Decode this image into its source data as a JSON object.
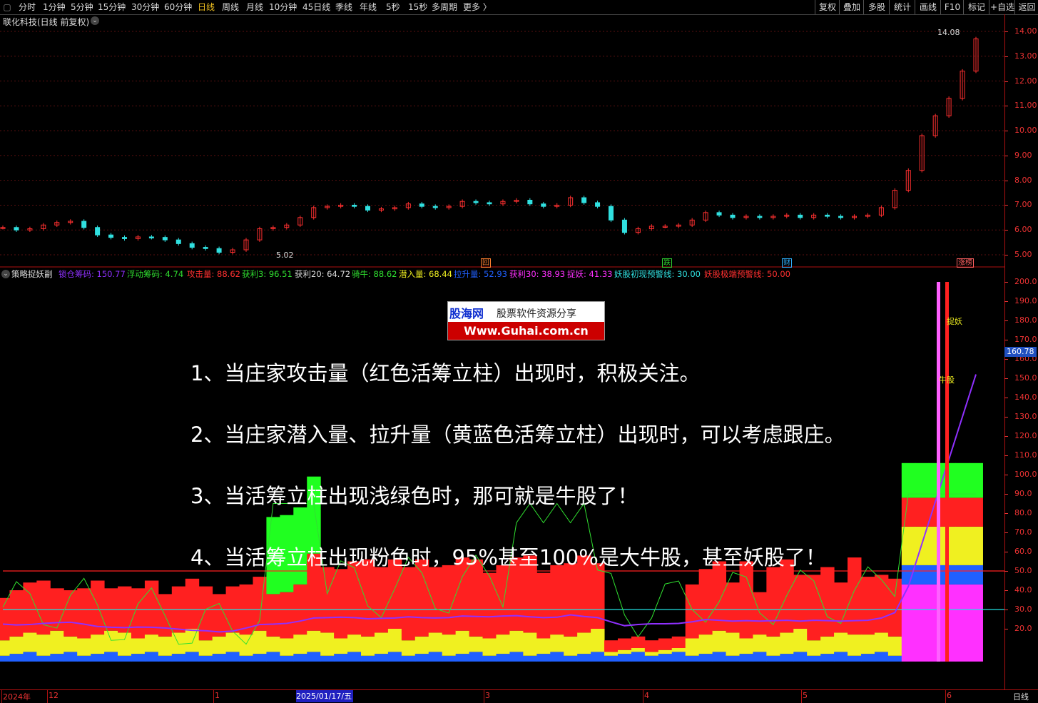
{
  "toolbar": {
    "periods": [
      "分时",
      "1分钟",
      "5分钟",
      "15分钟",
      "30分钟",
      "60分钟",
      "日线",
      "周线",
      "月线",
      "10分钟",
      "45日线",
      "季线",
      "年线",
      "5秒",
      "15秒",
      "多周期",
      "更多 〉"
    ],
    "active_period": "日线",
    "tools": [
      "复权",
      "叠加",
      "多股",
      "统计",
      "画线",
      "F10",
      "标记",
      "+自选",
      "返回"
    ]
  },
  "main_chart": {
    "title": "联化科技(日线 前复权)",
    "high_label": "14.08",
    "low_label": "5.02",
    "price_axis": [
      "14.00",
      "13.00",
      "12.00",
      "11.00",
      "10.00",
      "9.00",
      "8.00",
      "7.00",
      "6.00",
      "5.00"
    ],
    "markers": [
      {
        "text": "回",
        "color": "#ff8030"
      },
      {
        "text": "跌",
        "color": "#30d030"
      },
      {
        "text": "财",
        "color": "#30b0ff"
      },
      {
        "text": "涨榜",
        "color": "#ff6060"
      }
    ],
    "candles": [
      6.1,
      6.0,
      6.05,
      6.2,
      6.3,
      6.35,
      6.1,
      5.8,
      5.7,
      5.65,
      5.72,
      5.7,
      5.6,
      5.45,
      5.3,
      5.25,
      5.1,
      5.2,
      5.6,
      6.05,
      6.1,
      6.2,
      6.5,
      6.9,
      6.95,
      7.0,
      6.95,
      6.8,
      6.85,
      6.9,
      7.05,
      6.95,
      6.9,
      6.95,
      7.15,
      7.1,
      7.05,
      7.15,
      7.2,
      7.05,
      6.95,
      7.0,
      7.3,
      7.1,
      6.95,
      6.4,
      5.9,
      6.05,
      6.15,
      6.15,
      6.2,
      6.4,
      6.7,
      6.6,
      6.5,
      6.55,
      6.5,
      6.55,
      6.6,
      6.5,
      6.6,
      6.55,
      6.5,
      6.55,
      6.6,
      6.9,
      7.6,
      8.4,
      9.8,
      10.6,
      11.3,
      12.4,
      13.7
    ]
  },
  "indicator": {
    "name": "策略捉妖副",
    "items": [
      {
        "text": "锁仓筹码: 150.77",
        "color": "#9030ff"
      },
      {
        "text": "浮动筹码: 4.74",
        "color": "#30e030"
      },
      {
        "text": "攻击量: 88.62",
        "color": "#ff3030"
      },
      {
        "text": "获利3: 96.51",
        "color": "#30e030"
      },
      {
        "text": "获利20: 64.72",
        "color": "#dddddd"
      },
      {
        "text": "骑牛: 88.62",
        "color": "#30e030"
      },
      {
        "text": "潜入量: 68.44",
        "color": "#f0f020"
      },
      {
        "text": "拉升量: 52.93",
        "color": "#2060ff"
      },
      {
        "text": "获利30: 38.93",
        "color": "#ff30ff"
      },
      {
        "text": "捉妖: 41.33",
        "color": "#ff30ff"
      },
      {
        "text": "妖股初现预警线: 30.00",
        "color": "#30e0e0"
      },
      {
        "text": "妖股极端预警线: 50.00",
        "color": "#ff3030"
      }
    ],
    "axis": [
      "200.0",
      "190.0",
      "180.0",
      "170.0",
      "160.0",
      "150.0",
      "140.0",
      "130.0",
      "120.0",
      "110.0",
      "100.0",
      "90.0",
      "80.0",
      "70.0",
      "60.0",
      "50.0",
      "40.0",
      "30.0",
      "20.0"
    ],
    "current_badge": "160.78",
    "annot_zhuoyao": "捉妖",
    "annot_niugu": "牛股",
    "warning_line_extreme": 50,
    "warning_line_initial": 30
  },
  "date_axis": {
    "labels": [
      "2024年",
      "12",
      "1",
      "3",
      "4",
      "5",
      "6"
    ],
    "highlighted": "2025/01/17/五",
    "timeframe": "日线"
  },
  "overlay": {
    "logo_title": "股海网",
    "logo_subtitle": "股票软件资源分享",
    "logo_url": "Www.Guhai.com.cn",
    "lines": [
      "1、当庄家攻击量（红色活筹立柱）出现时，积极关注。",
      "2、当庄家潜入量、拉升量（黄蓝色活筹立柱）出现时，可以考虑跟庄。",
      "3、当活筹立柱出现浅绿色时，那可就是牛股了！",
      "4、当活筹立柱出现粉色时，95%甚至100%是大牛股，甚至妖股了！"
    ]
  }
}
